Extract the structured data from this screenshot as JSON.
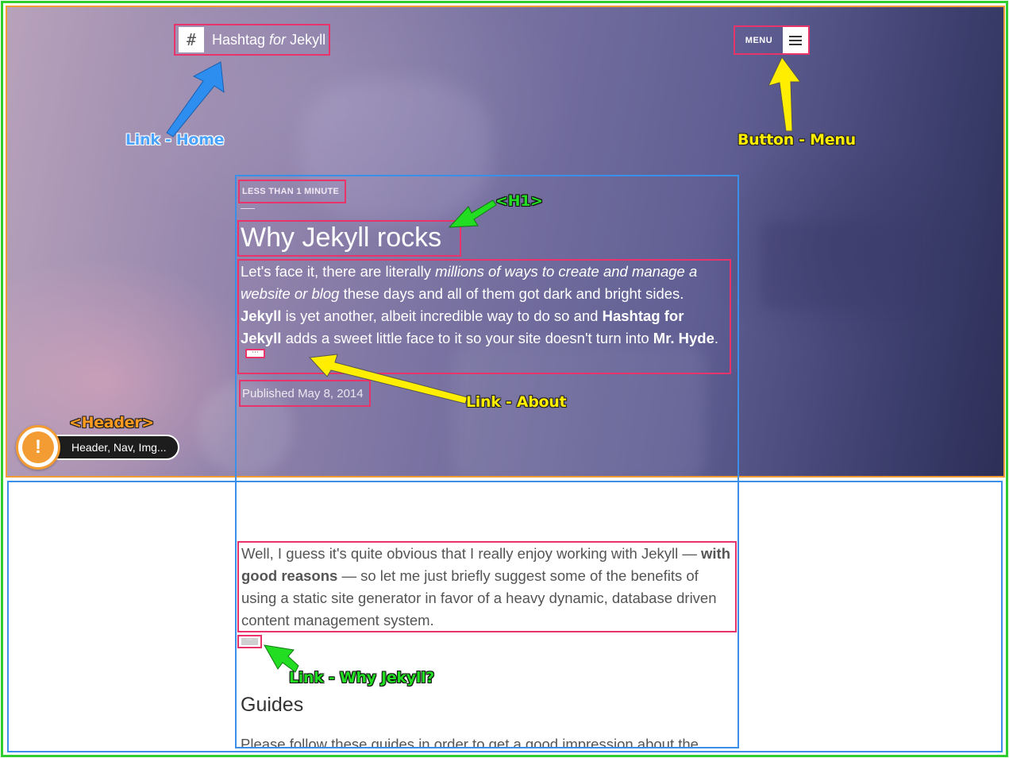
{
  "header": {
    "home_icon": "hash-icon",
    "home_glyph": "#",
    "site_title_part1": "Hashtag ",
    "site_title_part2": "for",
    "site_title_part3": " Jekyll",
    "menu_label": "MENU",
    "menu_icon": "hamburger-icon"
  },
  "post": {
    "reading_time": "LESS THAN 1 MINUTE",
    "title": "Why Jekyll rocks",
    "excerpt": {
      "t1": "Let's face it, there are literally ",
      "t2": "millions of ways to create and manage a website or blog",
      "t3": " these days and all of them got dark and bright sides. ",
      "t4": "Jekyll",
      "t5": " is yet another, albeit incredible way to do so and ",
      "t6": "Hashtag for Jekyll",
      "t7": " adds a sweet little face to it so your site doesn't turn into ",
      "t8": "Mr. Hyde",
      "t9": "."
    },
    "more_glyph": "···",
    "published_label": "Published",
    "published_date": "May 8, 2014"
  },
  "content": {
    "intro": {
      "t1": "Well, I guess it's quite obvious that I really enjoy working with Jekyll — ",
      "t2": "with good reasons",
      "t3": " — so let me just briefly suggest some of the benefits of using a static site generator in favor of a heavy dynamic, database driven content management system."
    },
    "more_glyph": "···",
    "guides_heading": "Guides",
    "guides_text": "Please follow these guides in order to get a good impression about the"
  },
  "annotations": {
    "link_home": "Link - Home",
    "button_menu": "Button - Menu",
    "h1": "<H1>",
    "link_about": "Link - About",
    "header_tag": "<Header>",
    "link_why": "Link - Why Jekyll?",
    "warning_label": "Header, Nav, Img...",
    "warning_glyph": "!",
    "warning_icon": "alert-icon"
  },
  "colors": {
    "pink_outline": "#e8336b",
    "blue_outline": "#3a8fe8",
    "green_outline": "#2ecc2e",
    "orange_outline": "#f39c33"
  }
}
